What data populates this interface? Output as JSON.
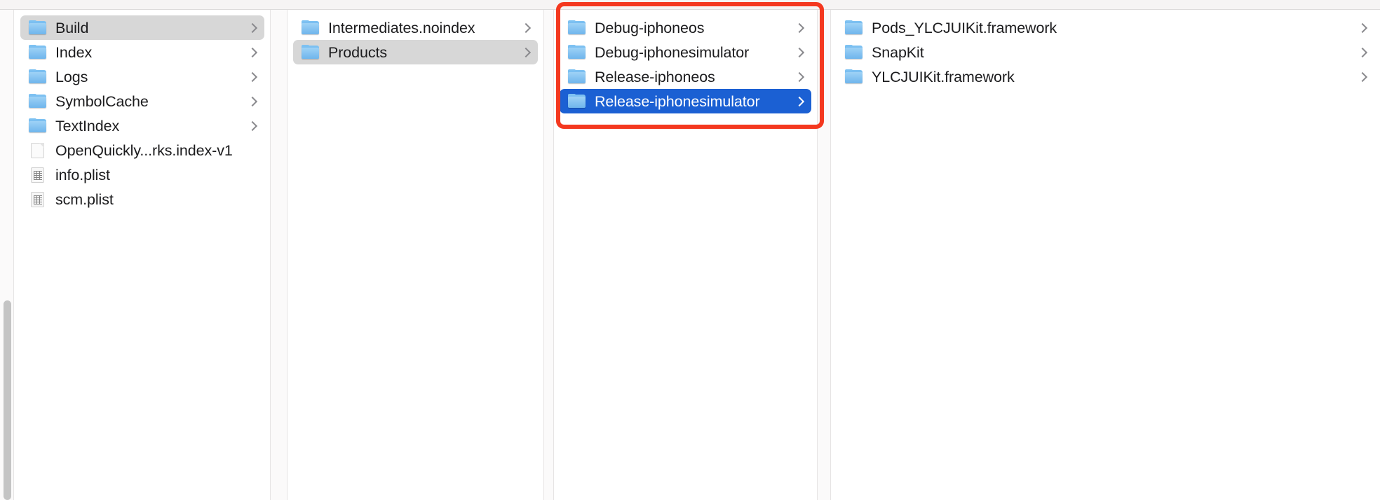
{
  "window": {
    "view_mode": "column-view",
    "selection_highlight_color": "#1b60d3",
    "inactive_selection_color": "#d7d7d7",
    "annotation_color": "#f4381f"
  },
  "columns": [
    {
      "name": "column-build-folder",
      "items": [
        {
          "label": "Build",
          "icon": "folder-icon",
          "has_chevron": true,
          "state": "selected-inactive"
        },
        {
          "label": "Index",
          "icon": "folder-icon",
          "has_chevron": true,
          "state": "normal"
        },
        {
          "label": "Logs",
          "icon": "folder-icon",
          "has_chevron": true,
          "state": "normal"
        },
        {
          "label": "SymbolCache",
          "icon": "folder-icon",
          "has_chevron": true,
          "state": "normal"
        },
        {
          "label": "TextIndex",
          "icon": "folder-icon",
          "has_chevron": true,
          "state": "normal"
        },
        {
          "label": "OpenQuickly...rks.index-v1",
          "icon": "document-icon",
          "has_chevron": false,
          "state": "normal"
        },
        {
          "label": "info.plist",
          "icon": "plist-icon",
          "has_chevron": false,
          "state": "normal"
        },
        {
          "label": "scm.plist",
          "icon": "plist-icon",
          "has_chevron": false,
          "state": "normal"
        }
      ]
    },
    {
      "name": "column-build-contents",
      "items": [
        {
          "label": "Intermediates.noindex",
          "icon": "folder-icon",
          "has_chevron": true,
          "state": "normal"
        },
        {
          "label": "Products",
          "icon": "folder-icon",
          "has_chevron": true,
          "state": "selected-inactive"
        }
      ]
    },
    {
      "name": "column-products-contents",
      "annotated": true,
      "items": [
        {
          "label": "Debug-iphoneos",
          "icon": "folder-icon",
          "has_chevron": true,
          "state": "normal"
        },
        {
          "label": "Debug-iphonesimulator",
          "icon": "folder-icon",
          "has_chevron": true,
          "state": "normal"
        },
        {
          "label": "Release-iphoneos",
          "icon": "folder-icon",
          "has_chevron": true,
          "state": "normal"
        },
        {
          "label": "Release-iphonesimulator",
          "icon": "folder-icon",
          "has_chevron": true,
          "state": "selected-active"
        }
      ]
    },
    {
      "name": "column-release-iphonesimulator-contents",
      "items": [
        {
          "label": "Pods_YLCJUIKit.framework",
          "icon": "folder-icon",
          "has_chevron": true,
          "state": "normal"
        },
        {
          "label": "SnapKit",
          "icon": "folder-icon",
          "has_chevron": true,
          "state": "normal"
        },
        {
          "label": "YLCJUIKit.framework",
          "icon": "folder-icon",
          "has_chevron": true,
          "state": "normal"
        }
      ]
    }
  ]
}
